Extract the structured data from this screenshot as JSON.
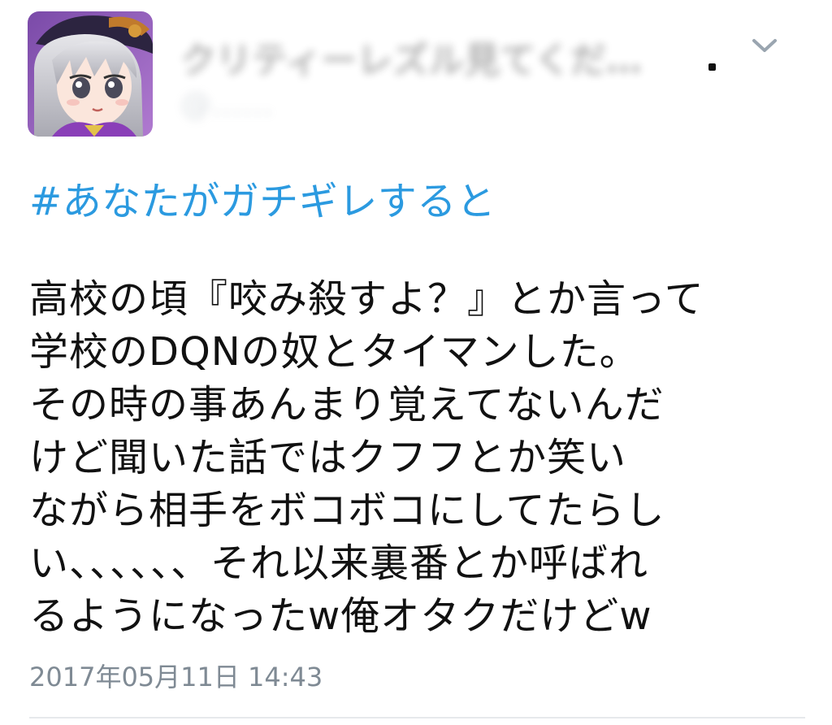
{
  "tweet": {
    "author": {
      "display_name": "クリティーレズル見てくだ…",
      "screen_name": "@……",
      "avatar_icon": "anime-avatar-icon"
    },
    "menu_icon": "chevron-down-icon",
    "hashtag": "#あなたがガチギレすると",
    "body_lines": [
      "高校の頃『咬み殺すよ？』とか言って",
      "学校のDQNの奴とタイマンした。",
      "その時の事あんまり覚えてないんだ",
      "けど聞いた話ではクフフとか笑い",
      "ながら相手をボコボコにしてたらし",
      "い、、、、、、それ以来裏番とか呼ばれ",
      "るようになったw俺オタクだけどw"
    ],
    "timestamp": "2017年05月11日 14:43"
  },
  "colors": {
    "hashtag": "#2b9ae0",
    "text": "#111111",
    "timestamp": "#7f8a94",
    "divider": "#e6e9ec"
  }
}
